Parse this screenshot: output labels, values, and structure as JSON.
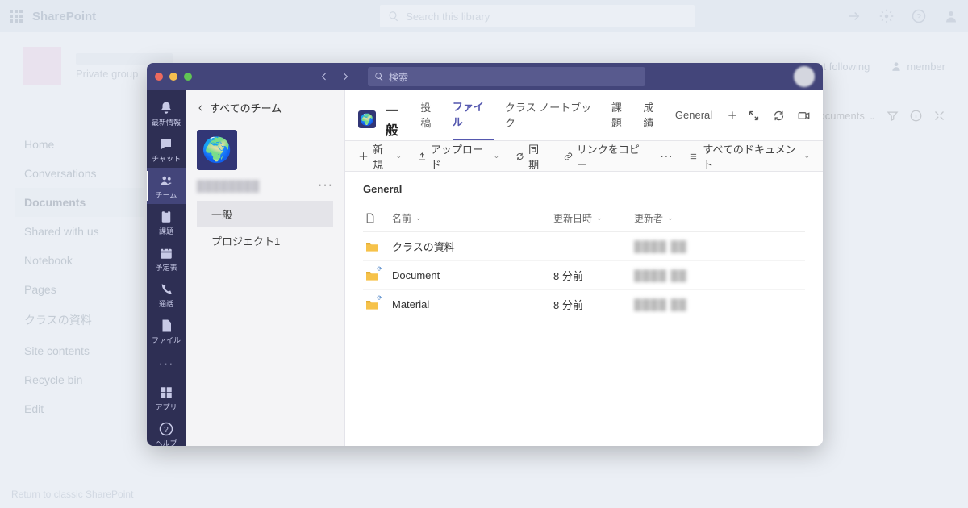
{
  "sharepoint": {
    "brand": "SharePoint",
    "search_placeholder": "Search this library",
    "group_label": "Private group",
    "not_following": "Not following",
    "member": "member",
    "docs_label": "Documents",
    "nav": [
      "Home",
      "Conversations",
      "Documents",
      "Shared with us",
      "Notebook",
      "Pages",
      "クラスの資料",
      "Site contents",
      "Recycle bin",
      "Edit"
    ],
    "return_link": "Return to classic SharePoint"
  },
  "teams": {
    "search_placeholder": "検索",
    "rail": [
      {
        "label": "最新情報",
        "name": "activity"
      },
      {
        "label": "チャット",
        "name": "chat"
      },
      {
        "label": "チーム",
        "name": "teams"
      },
      {
        "label": "課題",
        "name": "assignments"
      },
      {
        "label": "予定表",
        "name": "calendar"
      },
      {
        "label": "通話",
        "name": "calls"
      },
      {
        "label": "ファイル",
        "name": "files"
      }
    ],
    "rail_apps": "アプリ",
    "rail_help": "ヘルプ",
    "all_teams": "すべてのチーム",
    "channels": [
      {
        "label": "一般",
        "selected": true
      },
      {
        "label": "プロジェクト1",
        "selected": false
      }
    ],
    "channel_title": "一般",
    "tabs": [
      "投稿",
      "ファイル",
      "クラス ノートブック",
      "課題",
      "成績",
      "General"
    ],
    "active_tab": "ファイル",
    "cmdbar": {
      "new": "新規",
      "upload": "アップロード",
      "sync": "同期",
      "copy_link": "リンクをコピー",
      "all_docs": "すべてのドキュメント"
    },
    "folder_breadcrumb": "General",
    "columns": {
      "name": "名前",
      "modified": "更新日時",
      "modified_by": "更新者"
    },
    "files": [
      {
        "name": "クラスの資料",
        "modified": "",
        "sync": false
      },
      {
        "name": "Document",
        "modified": "8 分前",
        "sync": true
      },
      {
        "name": "Material",
        "modified": "8 分前",
        "sync": true
      }
    ]
  }
}
